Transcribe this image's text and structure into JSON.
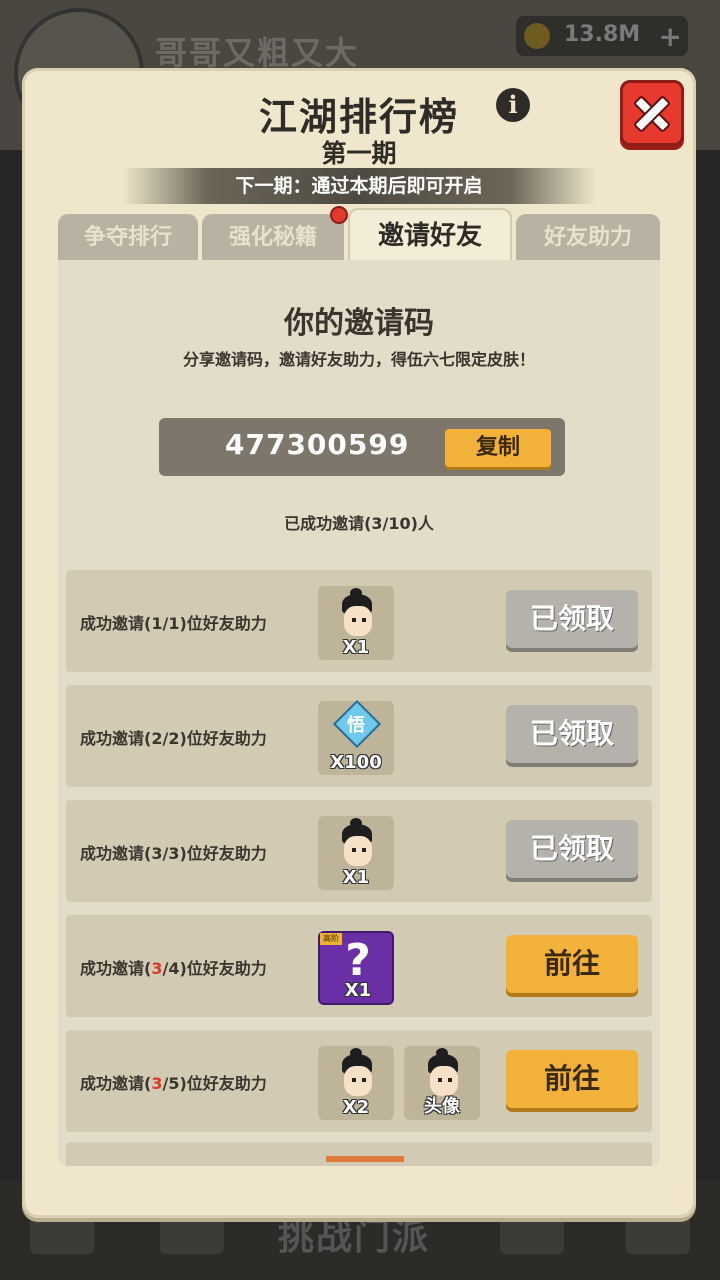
{
  "background": {
    "player_name": "哥哥又粗又大",
    "currency_value": "13.8M",
    "bottom_label": "挑战门派"
  },
  "header": {
    "title": "江湖排行榜",
    "subtitle": "第一期",
    "next_period": "下一期：通过本期后即可开启"
  },
  "tabs": [
    {
      "label": "争夺排行",
      "active": false
    },
    {
      "label": "强化秘籍",
      "active": false,
      "badge": true
    },
    {
      "label": "邀请好友",
      "active": true
    },
    {
      "label": "好友助力",
      "active": false
    }
  ],
  "invite": {
    "title": "你的邀请码",
    "description": "分享邀请码，邀请好友助力，得伍六七限定皮肤！",
    "code": "477300599",
    "copy_label": "复制",
    "count_text": "已成功邀请(3/10)人"
  },
  "rows": [
    {
      "label_pre": "成功邀请(",
      "label_hl": "1",
      "label_post": "/1)位好友助力",
      "hl_red": false,
      "rewards": [
        {
          "type": "character-face",
          "qty": "X1"
        }
      ],
      "button": "已领取",
      "state": "claimed"
    },
    {
      "label_pre": "成功邀请(",
      "label_hl": "2",
      "label_post": "/2)位好友助力",
      "hl_red": false,
      "rewards": [
        {
          "type": "diamond",
          "char": "悟",
          "qty": "X100"
        }
      ],
      "button": "已领取",
      "state": "claimed"
    },
    {
      "label_pre": "成功邀请(",
      "label_hl": "3",
      "label_post": "/3)位好友助力",
      "hl_red": false,
      "rewards": [
        {
          "type": "character-face",
          "qty": "X1"
        }
      ],
      "button": "已领取",
      "state": "claimed"
    },
    {
      "label_pre": "成功邀请(",
      "label_hl": "3",
      "label_post": "/4)位好友助力",
      "hl_red": true,
      "rewards": [
        {
          "type": "mystery-box",
          "tag": "高阶",
          "qty": "X1"
        }
      ],
      "button": "前往",
      "state": "go"
    },
    {
      "label_pre": "成功邀请(",
      "label_hl": "3",
      "label_post": "/5)位好友助力",
      "hl_red": true,
      "rewards": [
        {
          "type": "character-face",
          "qty": "X2"
        },
        {
          "type": "avatar",
          "qty": "头像"
        }
      ],
      "button": "前往",
      "state": "go"
    }
  ],
  "colors": {
    "panel_bg": "#efe6cc",
    "close_red": "#e8392f",
    "button_gold": "#f2b23a",
    "claimed_gray": "#b5b2ab",
    "highlight_red": "#d83a2a"
  }
}
